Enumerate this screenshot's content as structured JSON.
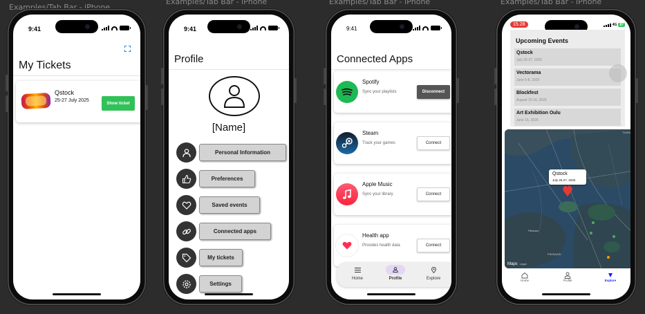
{
  "frame_labels": [
    "Examples/Tab Bar - iPhone",
    "Examples/Tab Bar - iPhone",
    "Examples/Tab Bar - iPhone",
    "Examples/Tab Bar - iPhone"
  ],
  "status": {
    "time": "9:41",
    "time_live": "15.28",
    "battery_live": "87",
    "network_live": "4G"
  },
  "tickets": {
    "title": "My Tickets",
    "items": [
      {
        "name": "Qstock",
        "date": "25-27 July 2025",
        "button": "Show ticket"
      }
    ]
  },
  "profile": {
    "title": "Profile",
    "name": "[Name]",
    "menu": [
      {
        "label": "Personal Information",
        "icon": "person-icon"
      },
      {
        "label": "Preferences",
        "icon": "thumbs-up-icon"
      },
      {
        "label": "Saved events",
        "icon": "heart-icon"
      },
      {
        "label": "Connected apps",
        "icon": "link-icon"
      },
      {
        "label": "My tickets",
        "icon": "tag-icon"
      },
      {
        "label": "Settings",
        "icon": "gear-icon"
      }
    ]
  },
  "connected_apps": {
    "title": "Connected Apps",
    "apps": [
      {
        "name": "Spotify",
        "subtitle": "Sync your playlists",
        "button": "Disconnect",
        "color": "#1db954"
      },
      {
        "name": "Steam",
        "subtitle": "Track your games",
        "button": "Connect",
        "color": "#1b2838"
      },
      {
        "name": "Apple Music",
        "subtitle": "Sync your library",
        "button": "Connect",
        "color": "#fa2d48"
      },
      {
        "name": "Health app",
        "subtitle": "Provides health data",
        "button": "Connect",
        "color": "#ff2d55"
      }
    ],
    "tabs": [
      {
        "label": "Home",
        "icon": "menu-icon"
      },
      {
        "label": "Profile",
        "icon": "person-icon",
        "active": true
      },
      {
        "label": "Explore",
        "icon": "location-pin-icon"
      }
    ]
  },
  "explore": {
    "events_title": "Upcoming Events",
    "events": [
      {
        "name": "Qstock",
        "date": "July 25-27, 2025"
      },
      {
        "name": "Vectorama",
        "date": "June 5-8, 2025"
      },
      {
        "name": "Blockfest",
        "date": "August 15-16, 2025"
      },
      {
        "name": "Art Exhibition Oulu",
        "date": "June 15, 2025"
      }
    ],
    "map": {
      "popup_name": "Qstock",
      "popup_date": "July 25-27, 2025",
      "attribution": "Maps",
      "legal": "Legal",
      "places": [
        "Pikisaari",
        "PIKISAARI",
        "TUIRA"
      ]
    },
    "tabs": [
      {
        "label": "Home",
        "icon": "home-icon"
      },
      {
        "label": "Profile",
        "icon": "person-icon"
      },
      {
        "label": "Explore",
        "icon": "triangle-down-icon",
        "active": true
      }
    ]
  }
}
